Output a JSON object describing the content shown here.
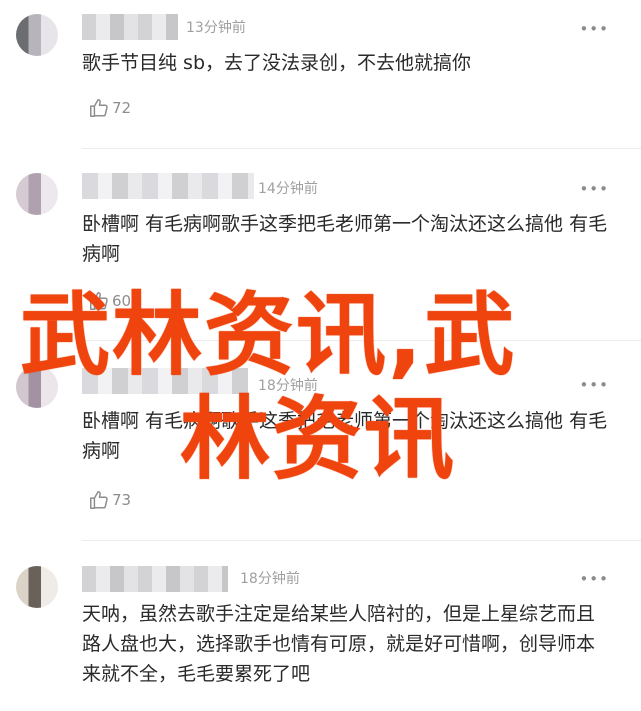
{
  "comments": [
    {
      "time": "13分钟前",
      "more": "•••",
      "text": "歌手节目纯 sb，去了没法录创，不去他就搞你",
      "likes": "72"
    },
    {
      "time": "14分钟前",
      "more": "•••",
      "text": "卧槽啊 有毛病啊歌手这季把毛老师第一个淘汰还这么搞他 有毛病啊",
      "likes": "60"
    },
    {
      "time": "18分钟前",
      "more": "•••",
      "text": "卧槽啊 有毛病啊歌手这季把毛老师第一个淘汰还这么搞他 有毛病啊",
      "likes": "73"
    },
    {
      "time": "18分钟前",
      "more": "•••",
      "text": "天呐，虽然去歌手注定是给某些人陪衬的，但是上星综艺而且路人盘也大，选择歌手也情有可原，就是好可惜啊，创导师本来就不全，毛毛要累死了吧"
    }
  ],
  "watermark": {
    "line1": "武林资讯,武",
    "line2": "林资讯",
    "color": "#f0440e"
  },
  "icons": {
    "like": "thumbs-up-icon",
    "more": "more-dots-icon"
  }
}
